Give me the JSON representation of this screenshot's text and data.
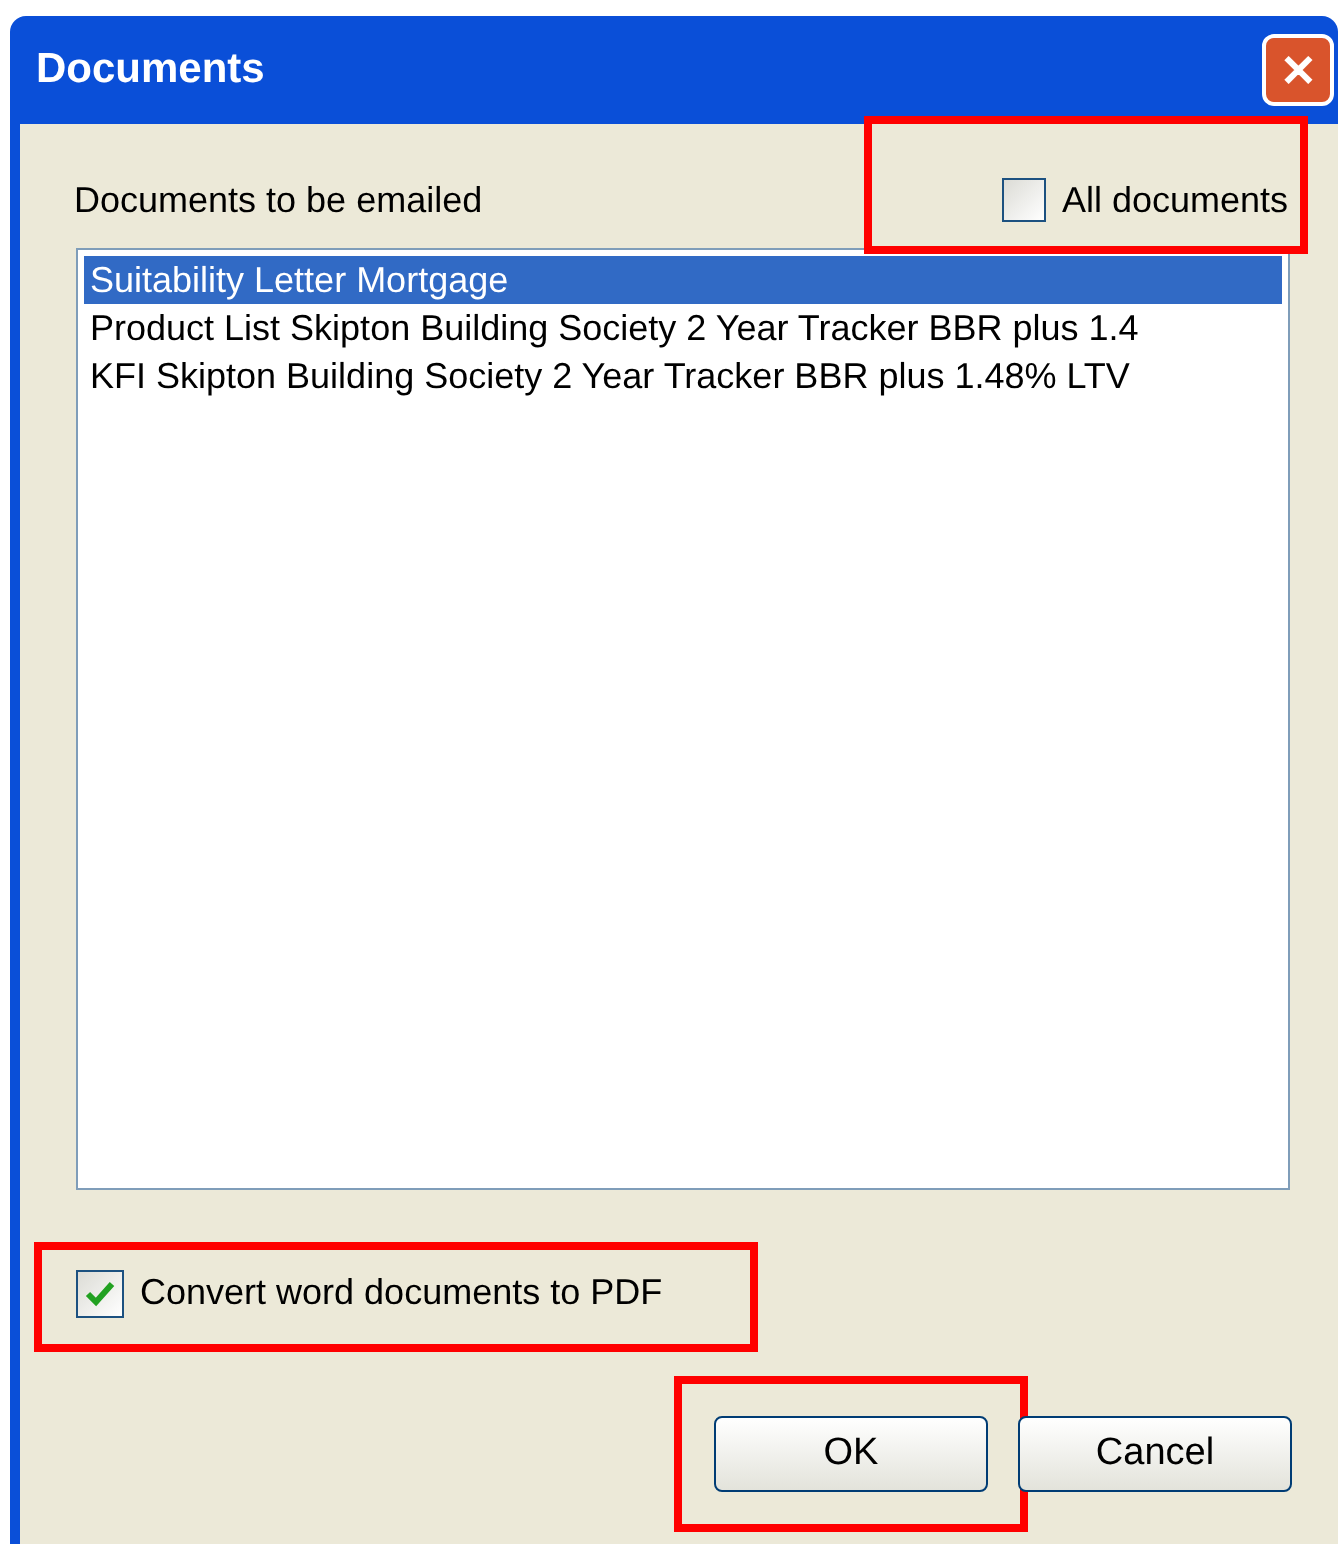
{
  "window": {
    "title": "Documents",
    "close": "✕"
  },
  "list_label": "Documents to be emailed",
  "all_documents": {
    "label": "All documents",
    "checked": false,
    "highlighted": true
  },
  "documents": [
    {
      "label": "Suitability Letter Mortgage",
      "selected": true
    },
    {
      "label": "Product List Skipton Building Society 2 Year Tracker BBR plus 1.4",
      "selected": false
    },
    {
      "label": "KFI Skipton Building Society 2 Year Tracker BBR plus 1.48% LTV",
      "selected": false
    }
  ],
  "convert_pdf": {
    "label": "Convert word documents to PDF",
    "checked": true,
    "highlighted": true
  },
  "buttons": [
    {
      "label": "OK",
      "highlighted": true
    },
    {
      "label": "Cancel",
      "highlighted": false
    }
  ]
}
